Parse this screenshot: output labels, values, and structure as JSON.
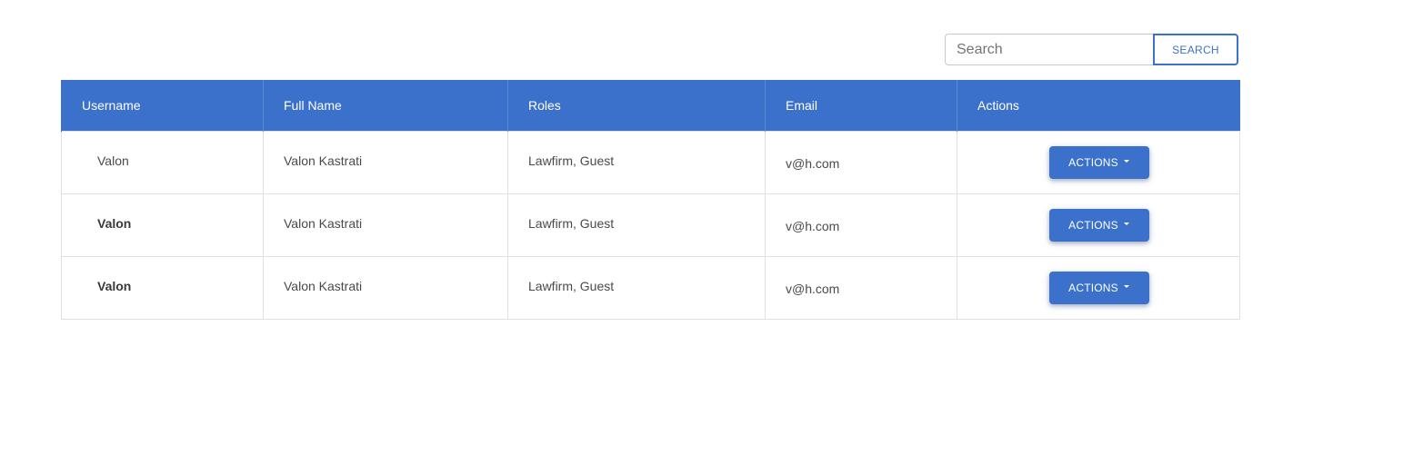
{
  "search": {
    "placeholder": "Search",
    "value": "",
    "button_label": "SEARCH"
  },
  "table": {
    "columns": [
      "Username",
      "Full Name",
      "Roles",
      "Email",
      "Actions"
    ],
    "rows": [
      {
        "username": "Valon",
        "full_name": "Valon Kastrati",
        "roles": "Lawfirm, Guest",
        "email": "v@h.com",
        "action_label": "ACTIONS"
      },
      {
        "username": "Valon",
        "full_name": "Valon Kastrati",
        "roles": "Lawfirm, Guest",
        "email": "v@h.com",
        "action_label": "ACTIONS"
      },
      {
        "username": "Valon",
        "full_name": "Valon Kastrati",
        "roles": "Lawfirm, Guest",
        "email": "v@h.com",
        "action_label": "ACTIONS"
      }
    ]
  },
  "icons": {
    "actions_dropdown": "caret-down-icon"
  },
  "colors": {
    "primary": "#3b71ca",
    "header_text": "#ffffff",
    "border": "#e0e0e0"
  }
}
